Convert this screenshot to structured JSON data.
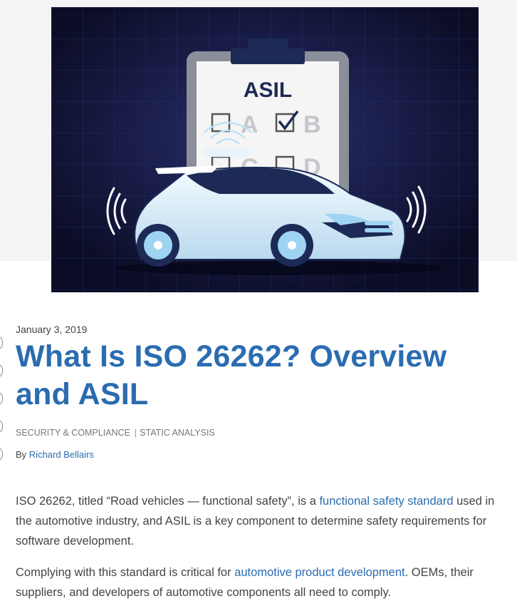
{
  "hero": {
    "clipboard_title": "ASIL",
    "options": [
      "A",
      "B",
      "C",
      "D"
    ],
    "checked_option": "B",
    "colors": {
      "background": "#0f1230",
      "grid": "#2a3a7a",
      "clipboard": "#8a8f99",
      "car_body": "#e8f3fb"
    }
  },
  "article": {
    "date": "January 3, 2019",
    "title": "What Is ISO 26262? Overview and ASIL",
    "categories": [
      "SECURITY & COMPLIANCE",
      "STATIC ANALYSIS"
    ],
    "category_separator": "|",
    "byline_prefix": "By",
    "author": "Richard Bellairs",
    "p1": {
      "before": "ISO 26262, titled “Road vehicles — functional safety”, is a ",
      "link": "functional safety standard",
      "after": " used in the automotive industry, and ASIL is a key component to determine safety requirements for software development."
    },
    "p2": {
      "before": "Complying with this standard is critical for ",
      "link": "automotive product development",
      "after": ". OEMs, their suppliers, and developers of automotive components all need to comply."
    }
  },
  "colors": {
    "link": "#2b6cb0",
    "title": "#2b6cb0",
    "muted": "#777777"
  }
}
